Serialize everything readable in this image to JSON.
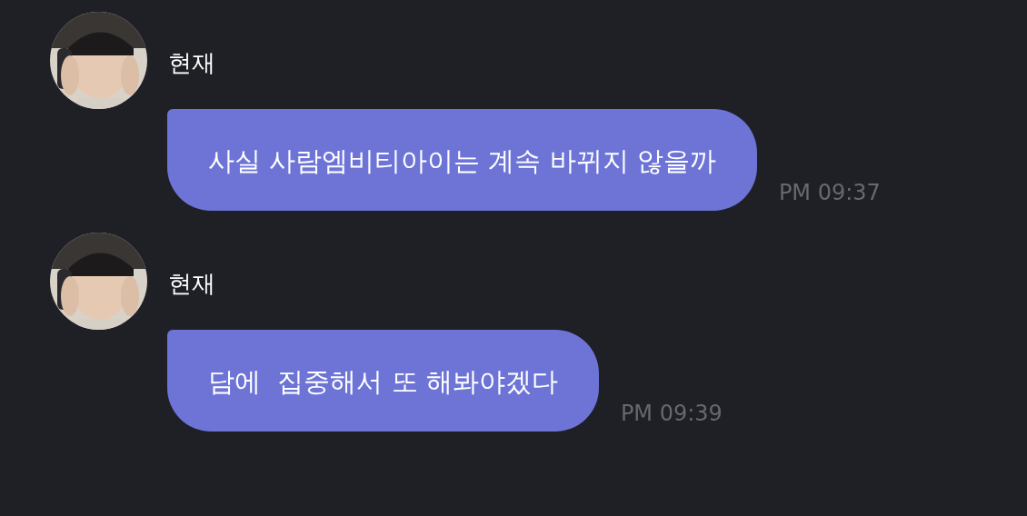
{
  "messages": [
    {
      "sender": "현재",
      "text": "사실 사람엠비티아이는 계속 바뀌지 않을까",
      "time": "PM 09:37"
    },
    {
      "sender": "현재",
      "text": "담에  집중해서 또 해봐야겠다",
      "time": "PM 09:39"
    }
  ]
}
